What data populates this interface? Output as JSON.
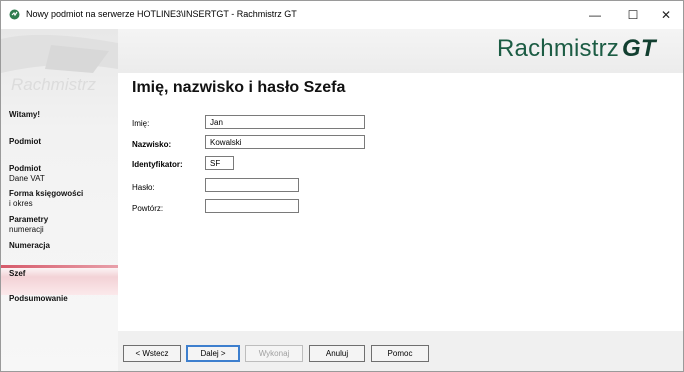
{
  "window": {
    "title": "Nowy podmiot na serwerze HOTLINE3\\INSERTGT - Rachmistrz GT",
    "min_glyph": "—",
    "max_glyph": "☐",
    "close_glyph": "✕"
  },
  "brand": {
    "name": "Rachmistrz",
    "suffix": "GT"
  },
  "sidebar": {
    "watermark": "Rachmistrz",
    "items": [
      {
        "label": "Witamy!",
        "sub": ""
      },
      {
        "label": "Podmiot",
        "sub": ""
      },
      {
        "label": "Podmiot",
        "sub": "Dane VAT"
      },
      {
        "label": "Forma księgowości",
        "sub": "i okres"
      },
      {
        "label": "Parametry",
        "sub": "numeracji"
      },
      {
        "label": "Numeracja",
        "sub": ""
      },
      {
        "label": "Szef",
        "sub": ""
      },
      {
        "label": "Podsumowanie",
        "sub": ""
      }
    ],
    "active_index": 6
  },
  "form": {
    "title": "Imię, nazwisko i hasło Szefa",
    "fields": [
      {
        "label": "Imię:",
        "value": "Jan"
      },
      {
        "label": "Nazwisko:",
        "value": "Kowalski"
      },
      {
        "label": "Identyfikator:",
        "value": "SF"
      },
      {
        "label": "Hasło:",
        "value": ""
      },
      {
        "label": "Powtórz:",
        "value": ""
      }
    ]
  },
  "buttons": {
    "back": "< Wstecz",
    "next": "Dalej >",
    "execute": "Wykonaj",
    "cancel": "Anuluj",
    "help": "Pomoc"
  },
  "colors": {
    "brand": "#1c5c44",
    "active_accent": "#d65a6a",
    "default_button_border": "#3d7fce"
  }
}
